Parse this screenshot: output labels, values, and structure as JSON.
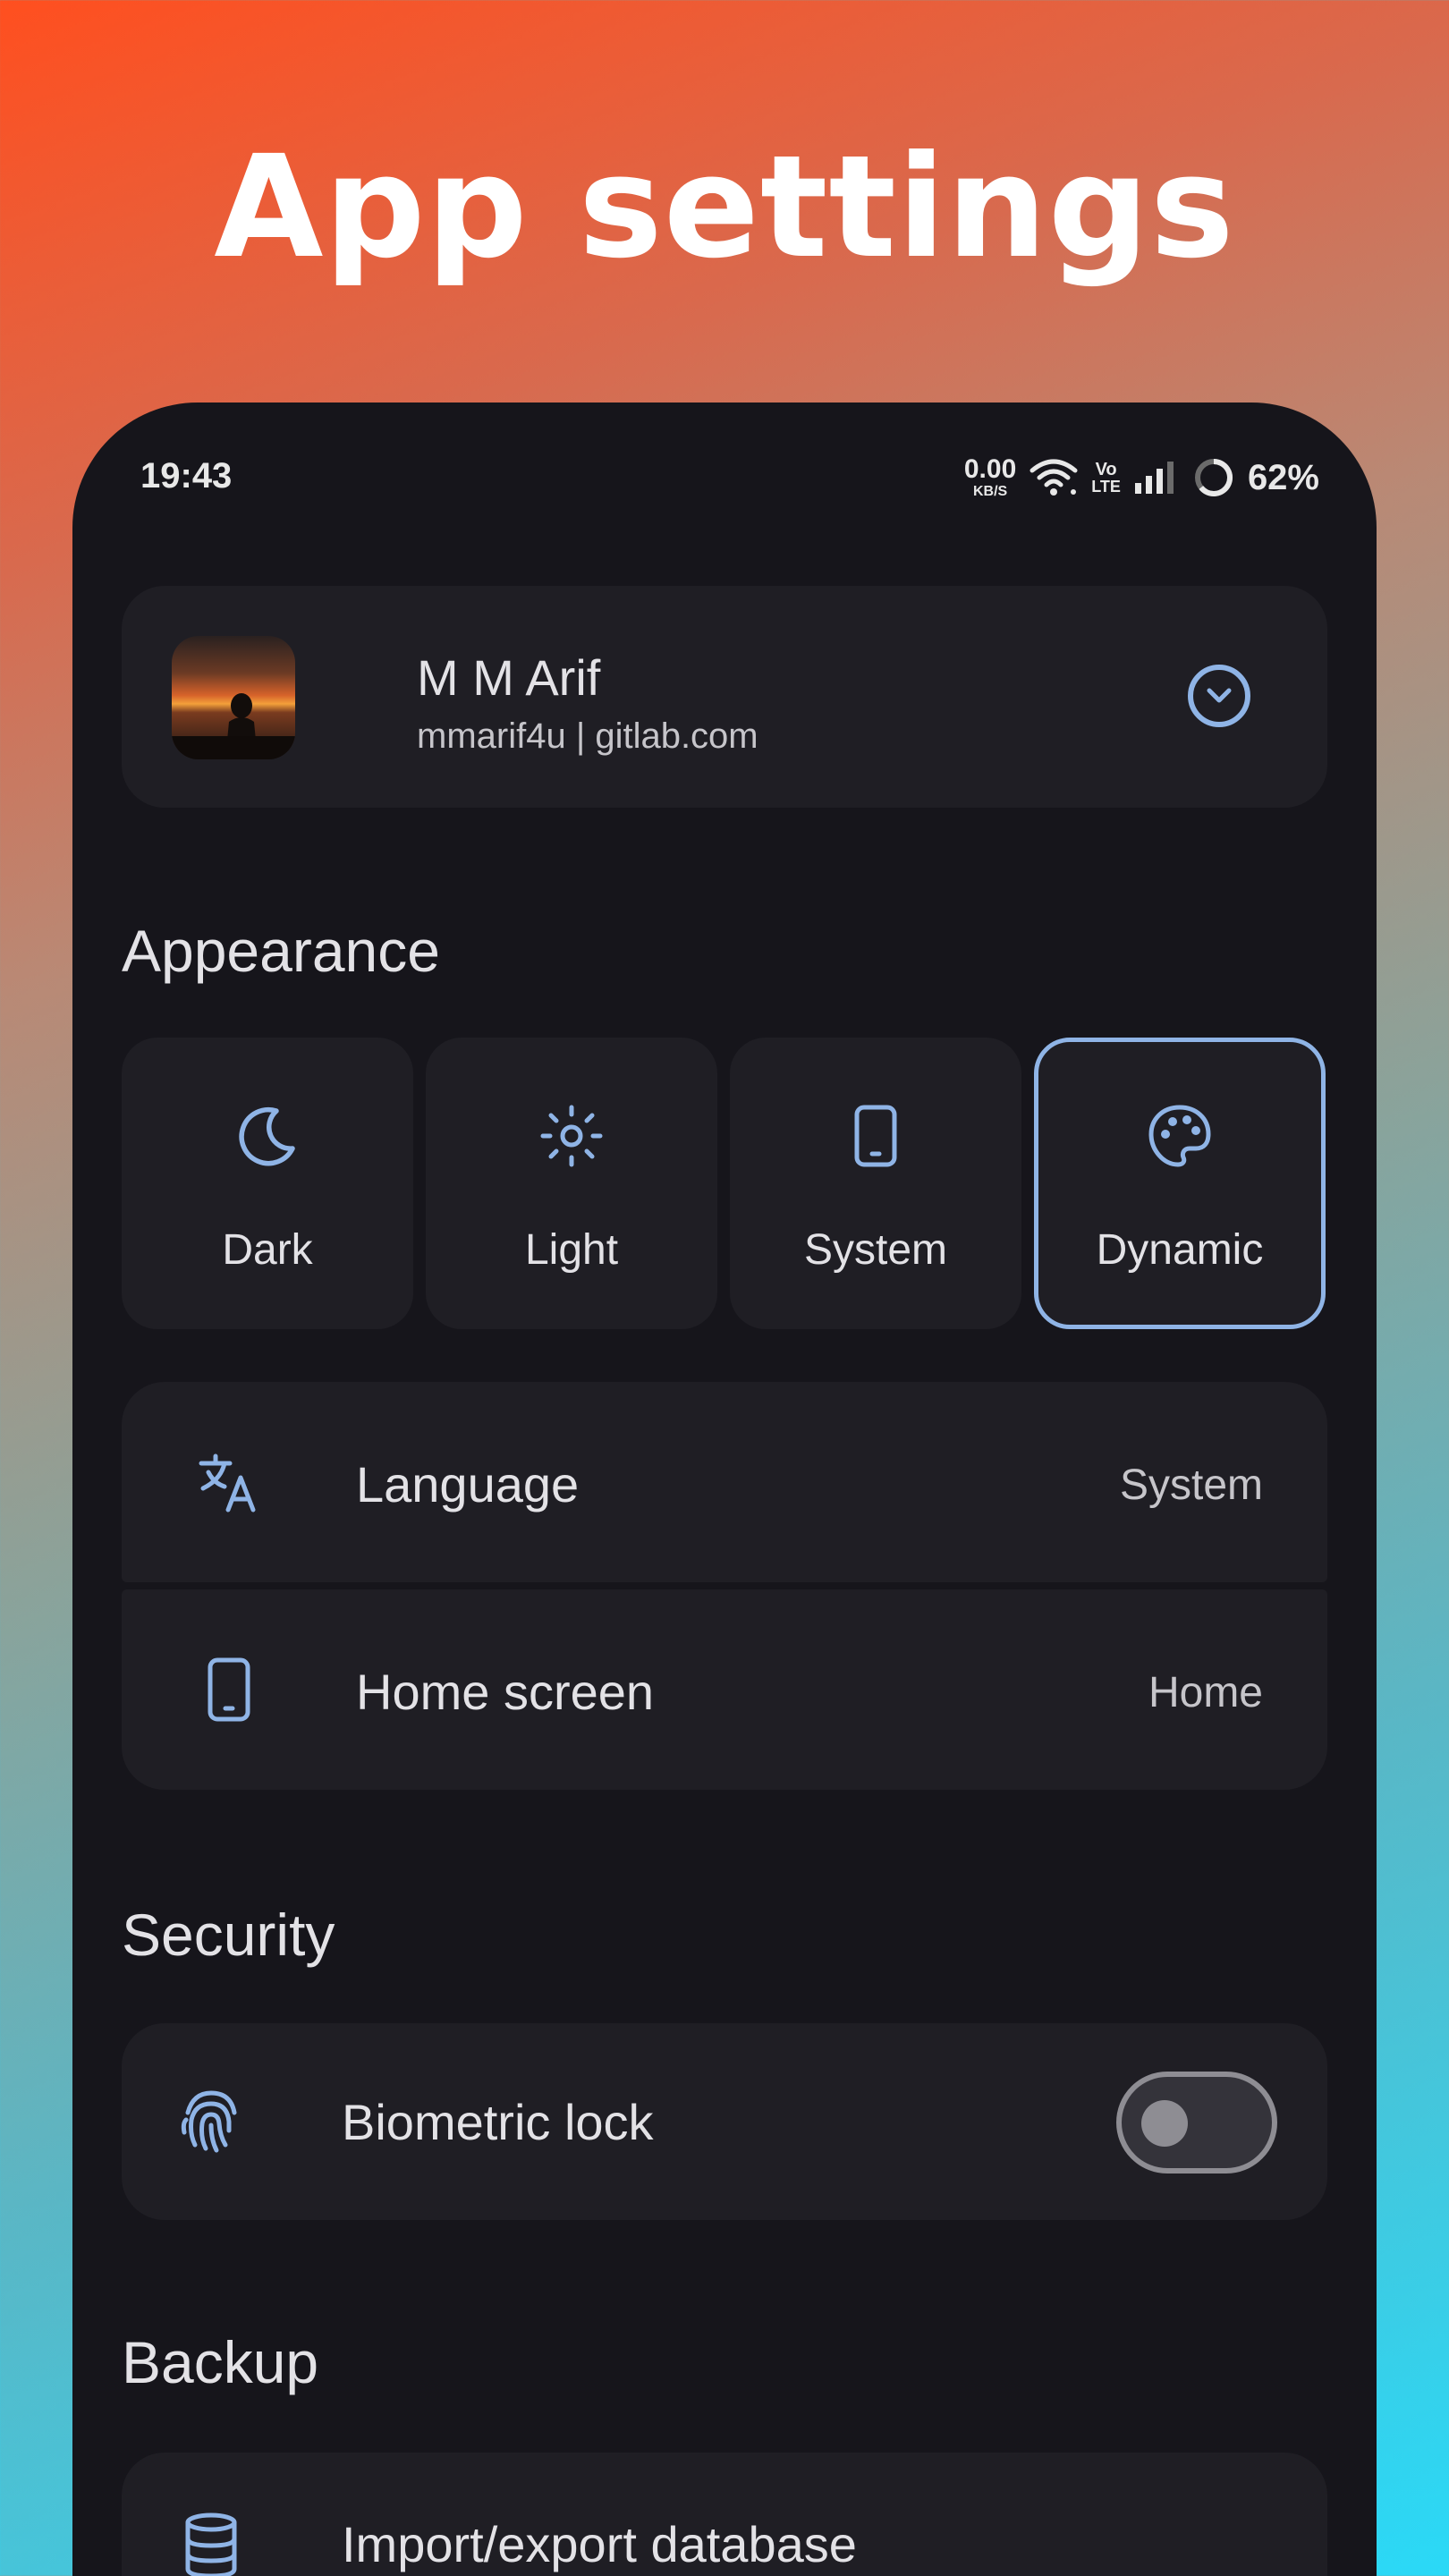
{
  "promo": {
    "title": "App settings"
  },
  "status_bar": {
    "time": "19:43",
    "net_speed_value": "0.00",
    "net_speed_unit": "KB/S",
    "volte_top": "Vo",
    "volte_bottom": "LTE",
    "battery_percent": "62%"
  },
  "account": {
    "name": "M M Arif",
    "subtitle": "mmarif4u | gitlab.com"
  },
  "appearance": {
    "title": "Appearance",
    "themes": [
      {
        "label": "Dark",
        "icon": "moon-icon",
        "selected": false
      },
      {
        "label": "Light",
        "icon": "sun-icon",
        "selected": false
      },
      {
        "label": "System",
        "icon": "phone-icon",
        "selected": false
      },
      {
        "label": "Dynamic",
        "icon": "palette-icon",
        "selected": true
      }
    ],
    "language": {
      "label": "Language",
      "value": "System",
      "icon": "translate-icon"
    },
    "home_screen": {
      "label": "Home screen",
      "value": "Home",
      "icon": "phone-icon"
    }
  },
  "security": {
    "title": "Security",
    "biometric": {
      "label": "Biometric lock",
      "enabled": false,
      "icon": "fingerprint-icon"
    }
  },
  "backup": {
    "title": "Backup",
    "import_export": {
      "label": "Import/export database",
      "icon": "database-icon"
    }
  },
  "colors": {
    "accent": "#8fb4e6",
    "surface": "#1f1e24",
    "background": "#16151b"
  }
}
